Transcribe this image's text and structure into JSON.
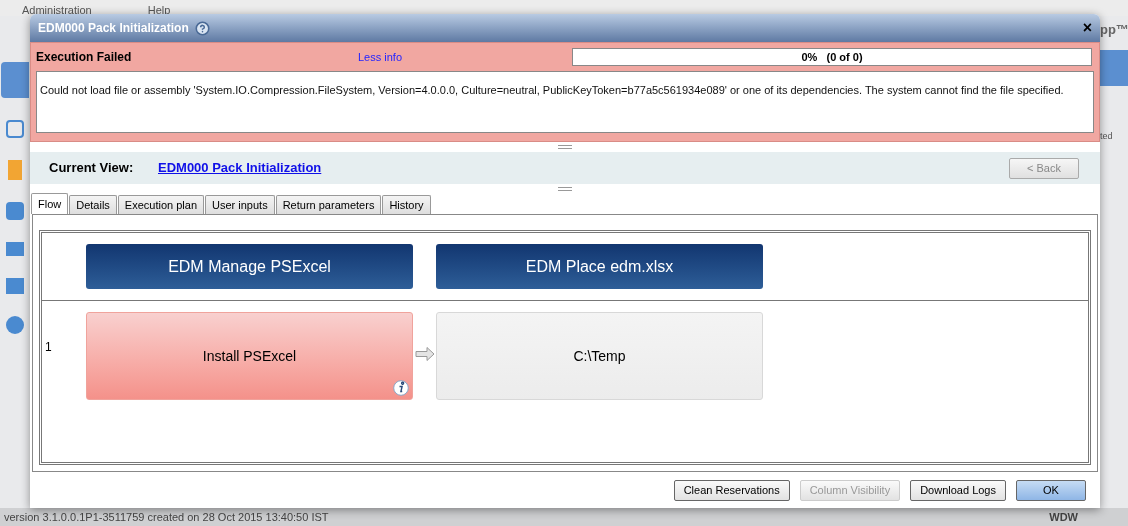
{
  "background": {
    "menu": [
      "Administration",
      "Help"
    ],
    "logo_fragment": "pp™",
    "column_fragment": "ted"
  },
  "dialog": {
    "title": "EDM000 Pack Initialization",
    "close": "×",
    "status": {
      "kind": "failed",
      "title": "Execution Failed",
      "toggle_link": "Less info",
      "progress": {
        "label": "0%   (0 of 0)",
        "level": 0
      },
      "message": "Could not load file or assembly 'System.IO.Compression.FileSystem, Version=4.0.0.0, Culture=neutral, PublicKeyToken=b77a5c561934e089' or one of its dependencies. The system cannot find the file specified."
    },
    "current_view": {
      "label": "Current View:",
      "link": "EDM000 Pack Initialization",
      "back_button": {
        "label": "< Back",
        "disabled": true
      }
    },
    "tabs": [
      {
        "label": "Flow",
        "selected": true
      },
      {
        "label": "Details",
        "selected": false
      },
      {
        "label": "Execution plan",
        "selected": false
      },
      {
        "label": "User inputs",
        "selected": false
      },
      {
        "label": "Return parameters",
        "selected": false
      },
      {
        "label": "History",
        "selected": false
      }
    ],
    "flow": {
      "columns": [
        "EDM Manage PSExcel",
        "EDM Place edm.xlsx"
      ],
      "rows": [
        {
          "number": "1",
          "steps": [
            {
              "label": "Install PSExcel",
              "failed": true,
              "info": true
            },
            {
              "label": "C:\\Temp",
              "failed": false,
              "info": false
            }
          ]
        }
      ]
    },
    "buttons": [
      {
        "label": "Clean Reservations",
        "disabled": false,
        "primary": false
      },
      {
        "label": "Column Visibility",
        "disabled": true,
        "primary": false
      },
      {
        "label": "Download Logs",
        "disabled": false,
        "primary": false
      },
      {
        "label": "OK",
        "disabled": false,
        "primary": true
      }
    ]
  },
  "status_bar": {
    "version": "version 3.1.0.0.1P1-3511759 created on 28 Oct 2015 13:40:50 IST",
    "user": "WDW"
  }
}
